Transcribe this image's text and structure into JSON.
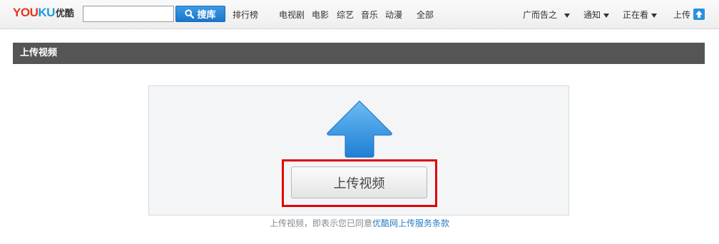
{
  "colors": {
    "accent": "#1a76cc",
    "header_bar": "#555555",
    "highlight": "#e00000",
    "link": "#2a7cc4"
  },
  "topbar": {
    "logo": {
      "letters": [
        {
          "ch": "Y",
          "color": "#e8341c"
        },
        {
          "ch": "O",
          "color": "#e8341c"
        },
        {
          "ch": "U",
          "color": "#e8341c"
        },
        {
          "ch": "K",
          "color": "#1a9ae0"
        },
        {
          "ch": "U",
          "color": "#1a9ae0"
        }
      ],
      "cn": "优酷"
    },
    "search": {
      "value": "",
      "placeholder": "",
      "button_label": "搜库",
      "icon": "search-icon"
    },
    "nav": [
      "排行榜",
      "电视剧",
      "电影",
      "综艺",
      "音乐",
      "动漫",
      "全部"
    ],
    "right": {
      "user": "广而告之",
      "notify": "通知",
      "watching": "正在看",
      "upload": "上传",
      "upload_icon": "upload-arrow-icon"
    }
  },
  "section": {
    "title": "上传视频"
  },
  "upload": {
    "arrow_icon": "big-upload-arrow-icon",
    "button_label": "上传视频",
    "terms_prefix": "上传视频，即表示您已同意",
    "terms_link": "优酷网上传服务条款"
  }
}
